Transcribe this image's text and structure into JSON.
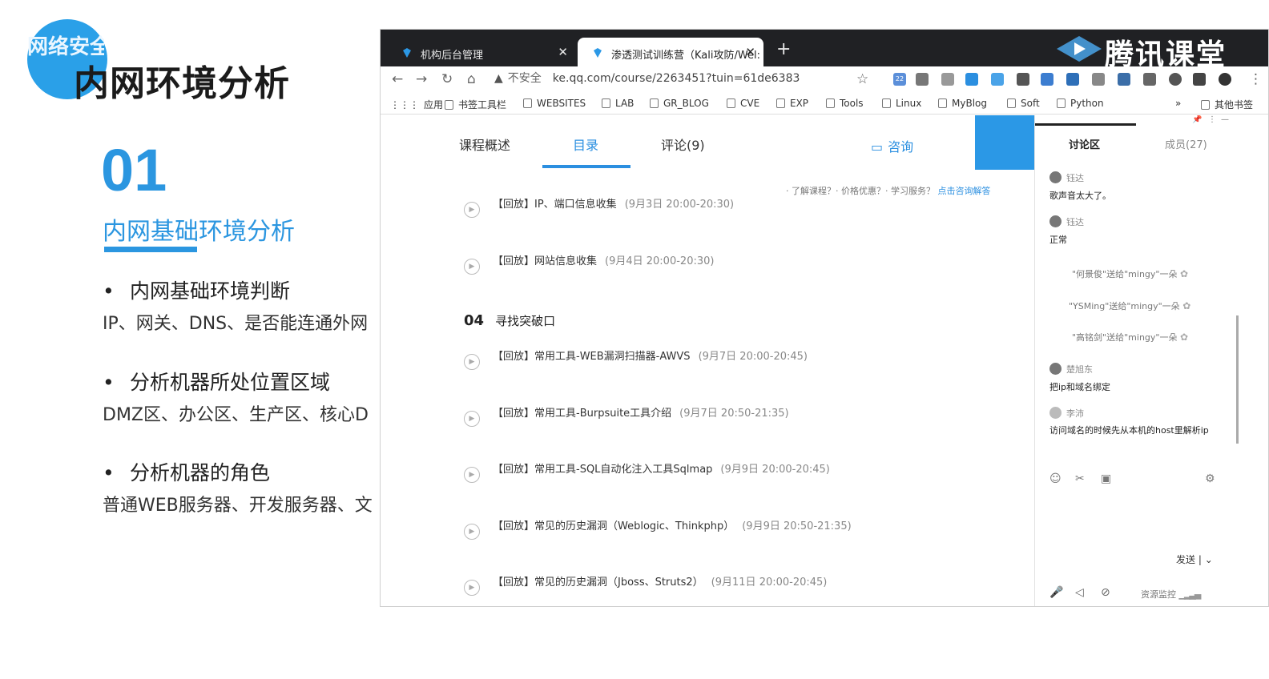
{
  "slide": {
    "logo_text": "网络安全",
    "title": "内网环境分析",
    "section_number": "01",
    "subtitle": "内网基础环境分析",
    "bullets": [
      {
        "heading": "内网基础环境判断",
        "detail": "IP、网关、DNS、是否能连通外网"
      },
      {
        "heading": "分析机器所处位置区域",
        "detail": "DMZ区、办公区、生产区、核心D"
      },
      {
        "heading": "分析机器的角色",
        "detail": "普通WEB服务器、开发服务器、文"
      }
    ]
  },
  "browser": {
    "tabs": [
      {
        "label": "机构后台管理",
        "close": "✕"
      },
      {
        "label": "渗透测试训练营（Kali攻防/Wel:",
        "close": "✕"
      }
    ],
    "new_tab": "+",
    "brand": "腾讯课堂",
    "insecure_label": "不安全",
    "url": "ke.qq.com/course/2263451?tuin=61de6383",
    "ext_badge": "22",
    "bookmarks": [
      "应用",
      "书签工具栏",
      "WEBSITES",
      "LAB",
      "GR_BLOG",
      "CVE",
      "EXP",
      "Tools",
      "Linux",
      "MyBlog",
      "Soft",
      "Python",
      "»",
      "其他书签"
    ]
  },
  "course": {
    "tabs": [
      "课程概述",
      "目录",
      "评论(9)"
    ],
    "consult": "咨询",
    "help_text": "· 了解课程？· 价格优惠？· 学习服务？",
    "help_link": "点击咨询解答",
    "chapter": {
      "number": "04",
      "title": "寻找突破口"
    },
    "lessons": [
      {
        "title": "【回放】IP、端口信息收集",
        "time": "(9月3日 20:00-20:30)"
      },
      {
        "title": "【回放】网站信息收集",
        "time": "(9月4日 20:00-20:30)"
      },
      {
        "title": "【回放】常用工具-WEB漏洞扫描器-AWVS",
        "time": "(9月7日 20:00-20:45)"
      },
      {
        "title": "【回放】常用工具-Burpsuite工具介绍",
        "time": "(9月7日 20:50-21:35)"
      },
      {
        "title": "【回放】常用工具-SQL自动化注入工具Sqlmap",
        "time": "(9月9日 20:00-20:45)"
      },
      {
        "title": "【回放】常见的历史漏洞（Weblogic、Thinkphp）",
        "time": "(9月9日 20:50-21:35)"
      },
      {
        "title": "【回放】常见的历史漏洞（Jboss、Struts2）",
        "time": "(9月11日 20:00-20:45)"
      }
    ]
  },
  "discussion": {
    "tab_active": "讨论区",
    "tab_members": "成员(27)",
    "messages": [
      {
        "user": "钰达",
        "text": "歌声音太大了。"
      },
      {
        "user": "钰达",
        "text": "正常"
      },
      {
        "user": "楚旭东",
        "text": "把ip和域名绑定"
      },
      {
        "user": "李沛",
        "text": "访问域名的时候先从本机的host里解析ip"
      }
    ],
    "gifts": [
      "\"何景俊\"送给\"mingy\"一朵",
      "\"YSMing\"送给\"mingy\"一朵",
      "\"高铭剑\"送给\"mingy\"一朵"
    ],
    "send_label": "发送",
    "monitor_label": "资源监控"
  },
  "colors": {
    "accent": "#2b8fe0",
    "tabbar": "#202124",
    "slide_blue": "#2b96e0"
  }
}
